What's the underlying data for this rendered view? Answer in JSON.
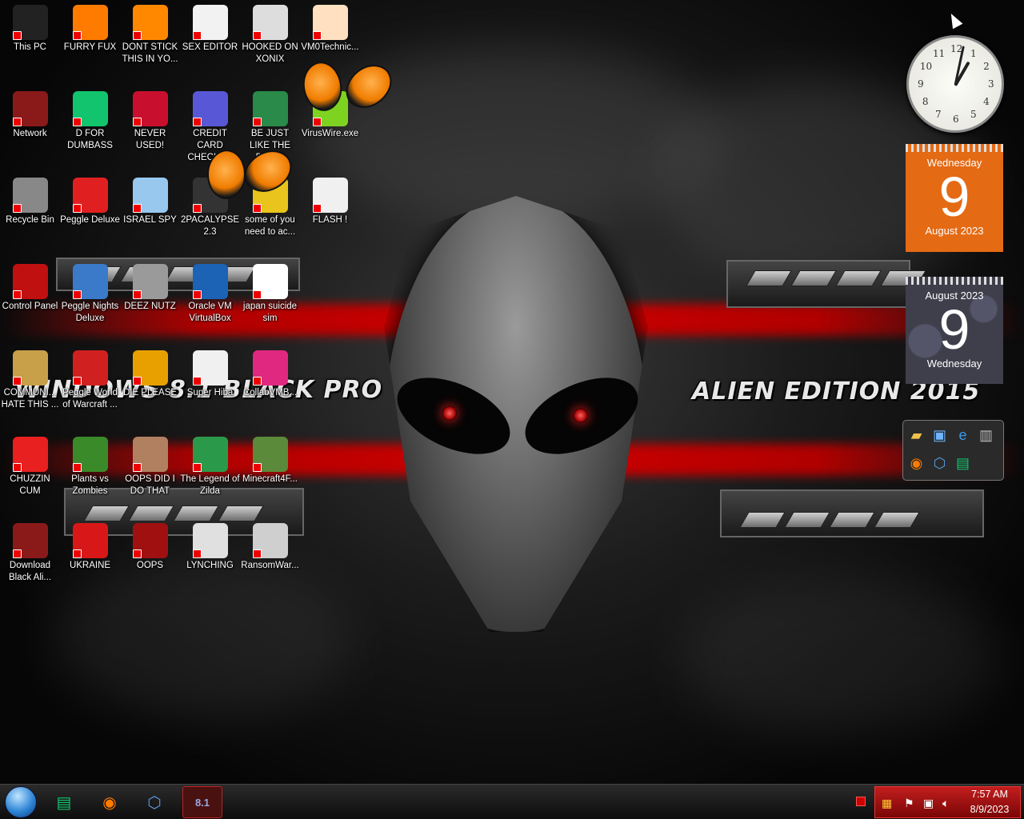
{
  "wallpaper": {
    "banner_left": "WINDOWS 8.1 BLACK PRO",
    "banner_right": "ALIEN EDITION 2015"
  },
  "desktop_icons": [
    {
      "label": "This PC",
      "icon": "computer-icon",
      "color": "#222"
    },
    {
      "label": "FURRY FUX",
      "icon": "firefox-icon",
      "color": "#ff7b00"
    },
    {
      "label": "DONT STICK THIS IN YO...",
      "icon": "vlc-cone-icon",
      "color": "#ff8800"
    },
    {
      "label": "SEX EDITOR",
      "icon": "hex-editor-icon",
      "color": "#f2f2f2"
    },
    {
      "label": "HOOKED ON XONIX",
      "icon": "xonix-game-icon",
      "color": "#dddddd"
    },
    {
      "label": "VM0Technic...",
      "icon": "doctor-icon",
      "color": "#ffe0c0"
    },
    {
      "label": "Network",
      "icon": "alien-network-icon",
      "color": "#8a1a1a"
    },
    {
      "label": "D FOR DUMBASS",
      "icon": "chat-app-icon",
      "color": "#12c46d"
    },
    {
      "label": "NEVER USED!",
      "icon": "dev-cpp-icon",
      "color": "#c8102e"
    },
    {
      "label": "CREDIT CARD CHECKER",
      "icon": "credit-card-icon",
      "color": "#5858d6"
    },
    {
      "label": "BE JUST LIKE THE DUDE!",
      "icon": "santa-game-icon",
      "color": "#2a8a4a"
    },
    {
      "label": "VirusWire.exe",
      "icon": "limewire-icon",
      "color": "#7ed321"
    },
    {
      "label": "Recycle Bin",
      "icon": "recycle-bin-icon",
      "color": "#888"
    },
    {
      "label": "Peggle Deluxe",
      "icon": "peggle-icon",
      "color": "#e02020"
    },
    {
      "label": "ISRAEL SPY",
      "icon": "network-spy-icon",
      "color": "#99c8ef"
    },
    {
      "label": "2PACALYPSE 2.3",
      "icon": "black-app-icon",
      "color": "#333"
    },
    {
      "label": "some of you need to ac...",
      "icon": "cartoon-dog-icon",
      "color": "#e8c41c"
    },
    {
      "label": "FLASH !",
      "icon": "flash-icon",
      "color": "#f0f0f0"
    },
    {
      "label": "Control Panel",
      "icon": "control-panel-icon",
      "color": "#c01010"
    },
    {
      "label": "Peggle Nights Deluxe",
      "icon": "peggle-nights-icon",
      "color": "#3a7ac8"
    },
    {
      "label": "DEEZ NUTZ",
      "icon": "stack-icon",
      "color": "#9a9a9a"
    },
    {
      "label": "Oracle VM VirtualBox",
      "icon": "virtualbox-icon",
      "color": "#1c62b5"
    },
    {
      "label": "japan suicide sim",
      "icon": "document-icon",
      "color": "#ffffff"
    },
    {
      "label": "COMMUNI... HATE THIS ...",
      "icon": "money-bag-icon",
      "color": "#c8a04a"
    },
    {
      "label": "Peggle World of Warcraft ...",
      "icon": "peggle-wow-icon",
      "color": "#d02020"
    },
    {
      "label": "DIE PLEASE",
      "icon": "de-app-icon",
      "color": "#e8a000"
    },
    {
      "label": "Super Hiba",
      "icon": "pixel-cat-icon",
      "color": "#f0f0f0"
    },
    {
      "label": "CollabVMB...",
      "icon": "collab-vm-icon",
      "color": "#e02880"
    },
    {
      "label": "CHUZZIN CUM",
      "icon": "chuzzle-icon",
      "color": "#e82020"
    },
    {
      "label": "Plants vs Zombies",
      "icon": "plant-icon",
      "color": "#3a8a2a"
    },
    {
      "label": "OOPS DID I DO THAT",
      "icon": "portrait-icon",
      "color": "#b08060"
    },
    {
      "label": "The Legend of Zilda",
      "icon": "zelda-icon",
      "color": "#2a9a4a"
    },
    {
      "label": "Minecraft4F...",
      "icon": "grass-block-icon",
      "color": "#5a8a3a"
    },
    {
      "label": "Download Black Ali...",
      "icon": "alien-download-icon",
      "color": "#8a1a1a"
    },
    {
      "label": "UKRAINE",
      "icon": "radiation-icon",
      "color": "#d81818"
    },
    {
      "label": "OOPS",
      "icon": "red-book-icon",
      "color": "#a01010"
    },
    {
      "label": "LYNCHING",
      "icon": "tree-network-icon",
      "color": "#e0e0e0"
    },
    {
      "label": "RansomWar...",
      "icon": "skull-icon",
      "color": "#cfcfcf"
    }
  ],
  "gadgets": {
    "calendar_orange": {
      "day_name": "Wednesday",
      "day_num": "9",
      "month_year": "August 2023"
    },
    "calendar_dark": {
      "month_year": "August 2023",
      "day_num": "9",
      "day_name": "Wednesday"
    },
    "clock_numerals": [
      "12",
      "1",
      "2",
      "3",
      "4",
      "5",
      "6",
      "7",
      "8",
      "9",
      "10",
      "11"
    ]
  },
  "taskbar": {
    "pinned": [
      {
        "name": "chat-app-icon",
        "glyph": "▤"
      },
      {
        "name": "firefox-icon",
        "glyph": "◉"
      },
      {
        "name": "virtualbox-icon",
        "glyph": "⬡"
      },
      {
        "name": "windows81-icon",
        "glyph": "8.1"
      }
    ],
    "tray_time": "7:57 AM",
    "tray_date": "8/9/2023"
  }
}
